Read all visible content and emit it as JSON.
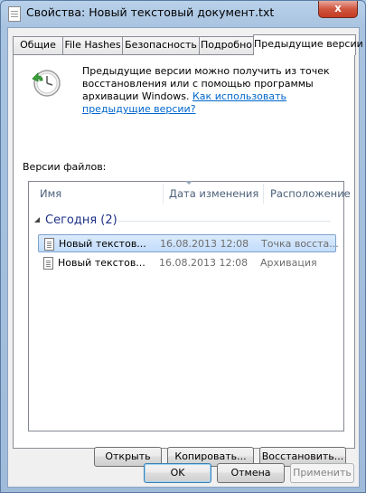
{
  "window": {
    "title": "Свойства: Новый текстовый документ.txt",
    "close_label": "x"
  },
  "tabs": [
    {
      "label": "Общие"
    },
    {
      "label": "File Hashes"
    },
    {
      "label": "Безопасность"
    },
    {
      "label": "Подробно"
    },
    {
      "label": "Предыдущие версии",
      "active": true
    }
  ],
  "panel": {
    "description": "Предыдущие версии можно получить из точек восстановления или с помощью программы архивации Windows.",
    "help_link": "Как использовать предыдущие версии?",
    "versions_label": "Версии файлов:",
    "columns": {
      "name": "Имя",
      "date": "Дата изменения",
      "location": "Расположение"
    },
    "group": {
      "label": "Сегодня (2)"
    },
    "rows": [
      {
        "name": "Новый текстов...",
        "date": "16.08.2013 12:08",
        "location": "Точка восста...",
        "selected": true
      },
      {
        "name": "Новый текстов...",
        "date": "16.08.2013 12:08",
        "location": "Архивация",
        "selected": false
      }
    ],
    "actions": {
      "open": "Открыть",
      "copy": "Копировать...",
      "restore": "Восстановить..."
    }
  },
  "dialog_buttons": {
    "ok": "OK",
    "cancel": "Отмена",
    "apply": "Применить"
  }
}
